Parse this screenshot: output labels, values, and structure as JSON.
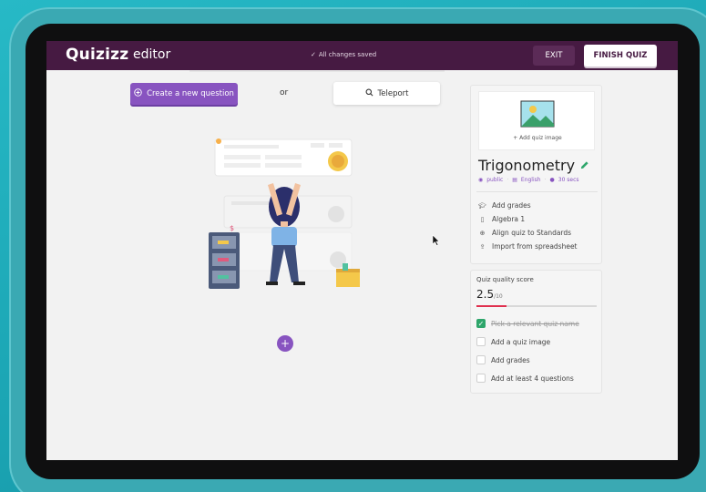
{
  "header": {
    "logo": "Quizizz",
    "logo_sub": "editor",
    "saved_status": "All changes saved",
    "exit_label": "EXIT",
    "finish_label": "FINISH QUIZ"
  },
  "toolbar": {
    "create_label": "Create a new question",
    "or_label": "or",
    "teleport_label": "Teleport"
  },
  "quiz": {
    "add_image_label": "+ Add quiz image",
    "title": "Trigonometry",
    "visibility": "public",
    "language": "English",
    "time": "30 secs",
    "actions": [
      {
        "label": "Add grades",
        "icon": "graduation-cap-icon"
      },
      {
        "label": "Algebra 1",
        "icon": "book-icon"
      },
      {
        "label": "Align quiz to Standards",
        "icon": "plus-circle-icon"
      },
      {
        "label": "Import from spreadsheet",
        "icon": "upload-icon"
      }
    ]
  },
  "quality": {
    "label": "Quiz quality score",
    "score": "2.5",
    "score_max": "/10",
    "score_fraction": 0.25,
    "checklist": [
      {
        "label": "Pick a relevant quiz name",
        "done": true
      },
      {
        "label": "Add a quiz image",
        "done": false
      },
      {
        "label": "Add grades",
        "done": false
      },
      {
        "label": "Add at least 4 questions",
        "done": false
      }
    ]
  },
  "colors": {
    "header_bg": "#461a42",
    "accent_purple": "#8854c0",
    "success_green": "#2ea66b",
    "score_red": "#e0304e"
  }
}
